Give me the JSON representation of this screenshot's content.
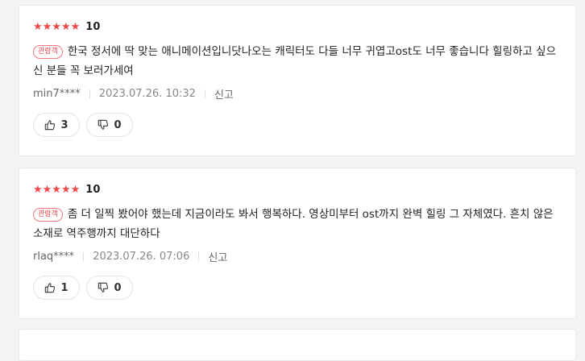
{
  "reviews": [
    {
      "stars": "★★★★★",
      "score": "10",
      "badge": "관람객",
      "text": "한국 정서에 딱 맞는 애니메이션입니닷나오는 캐릭터도 다들 너무 귀엽고ost도 너무 좋습니다 힐링하고 싶으신 분들 꼭 보러가세여",
      "user": "min7****",
      "date": "2023.07.26. 10:32",
      "report": "신고",
      "likes": "3",
      "dislikes": "0"
    },
    {
      "stars": "★★★★★",
      "score": "10",
      "badge": "관람객",
      "text": "좀 더 일찍 봤어야 했는데 지금이라도 봐서 행복하다. 영상미부터 ost까지 완벽 힐링 그 자체였다. 흔치 않은 소재로 역주행까지 대단하다",
      "user": "rlaq****",
      "date": "2023.07.26. 07:06",
      "report": "신고",
      "likes": "1",
      "dislikes": "0"
    }
  ],
  "colors": {
    "star": "#f1474a",
    "badge": "#f1474a"
  },
  "icons": {
    "like": "thumbs-up-icon",
    "dislike": "thumbs-down-icon"
  }
}
